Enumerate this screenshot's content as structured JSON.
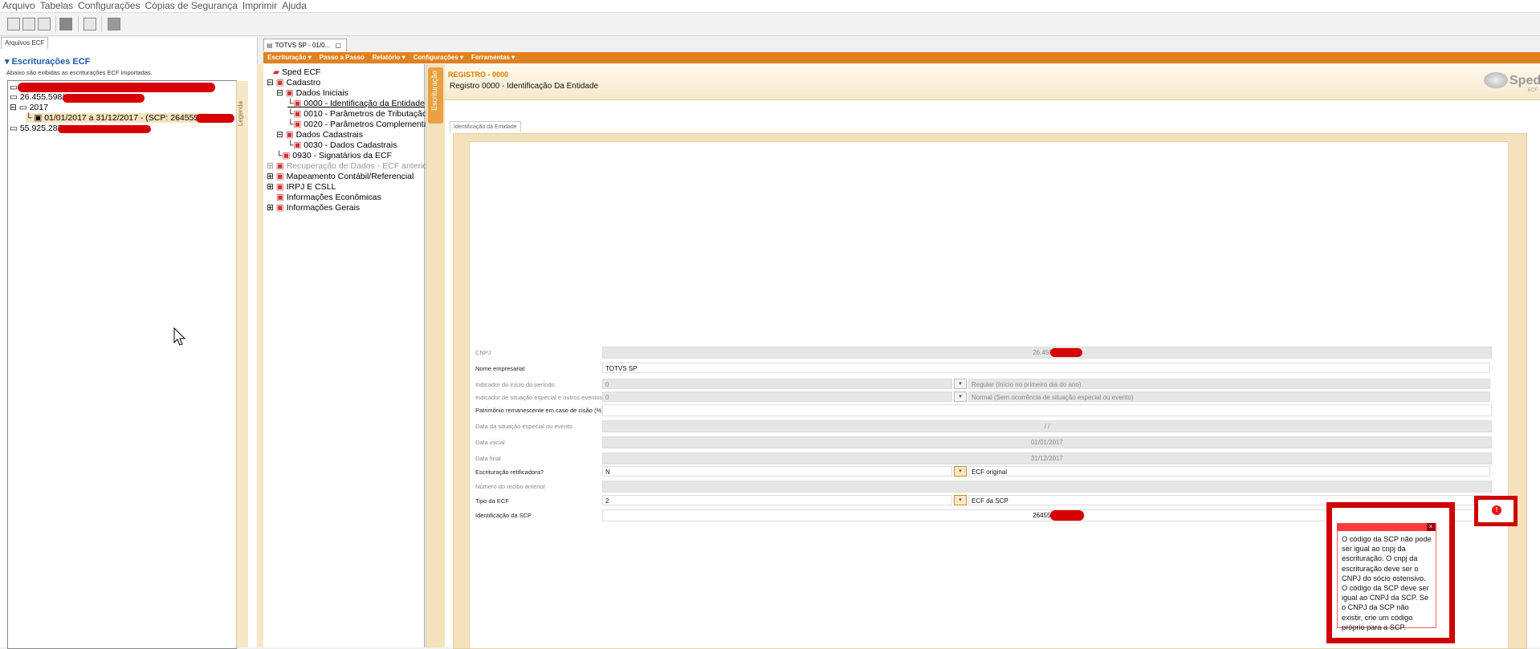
{
  "menu": [
    "Arquivo",
    "Tabelas",
    "Configurações",
    "Cópias de Segurança",
    "Imprimir",
    "Ajuda"
  ],
  "left_panel": {
    "tab": "Arquivos ECF",
    "title": "Escriturações ECF",
    "subtitle": "Abaixo são exibidas as escriturações ECF importadas.",
    "legend_label": "Legenda",
    "tree": {
      "item1": "26.455.598/",
      "year": "2017",
      "period": "01/01/2017 a 31/12/2017 - (SCP: 26455598",
      "item2": "55.925.283"
    }
  },
  "doc_tab": {
    "label": "TOTVS SP - 01/0..."
  },
  "orange_menu": [
    "Escrituração ▾",
    "Passo a Passo",
    "Relatório ▾",
    "Configurações ▾",
    "Ferramentas ▾"
  ],
  "nav_tree": {
    "root": "Sped ECF",
    "cadastro": "Cadastro",
    "dados_iniciais": "Dados Iniciais",
    "r0000": "0000 - Identificação da Entidade",
    "r0010": "0010 - Parâmetros de Tributação",
    "r0020": "0020 - Parâmetros Complementares",
    "dados_cadastrais": "Dados Cadastrais",
    "r0030": "0030 - Dados Cadastrais",
    "r0930": "0930 - Signatários da ECF",
    "recuperacao": "Recuperação de Dados - ECF anterior e EC",
    "mapeamento": "Mapeamento Contábil/Referencial",
    "irpj": "IRPJ E CSLL",
    "economicas": "Informações Econômicas",
    "gerais": "Informações Gerais"
  },
  "side_tab": "Escrituração",
  "register": {
    "code": "REGISTRO - 0000",
    "title": "Registro 0000 - Identificação Da Entidade",
    "subtab": "Identificação da Entidade"
  },
  "logo": {
    "text": "Sped",
    "sub": "ECF"
  },
  "form": {
    "cnpj_label": "CNPJ",
    "cnpj_value": "26.455.59",
    "nome_label": "Nome empresarial",
    "nome_value": "TOTVS SP",
    "ind_inicio_label": "Indicador do início do período",
    "ind_inicio_value": "0",
    "ind_inicio_desc": "Regular (Início no primeiro dia do ano)",
    "ind_sit_label": "Indicador de situação especial e outros eventos",
    "ind_sit_value": "0",
    "ind_sit_desc": "Normal (Sem ocorrência de situação especial ou evento)",
    "patrimonio_label": "Patrimônio remanescente em caso de cisão (%)",
    "data_sit_label": "Data da situação especial ou evento",
    "data_sit_value": "/ /",
    "data_ini_label": "Data inicial",
    "data_ini_value": "01/01/2017",
    "data_fin_label": "Data final",
    "data_fin_value": "31/12/2017",
    "retif_label": "Escrituração retificadora?",
    "retif_value": "N",
    "retif_desc": "ECF original",
    "recibo_label": "Número do recibo anterior",
    "tipo_label": "Tipo da ECF",
    "tipo_value": "2",
    "tipo_desc": "ECF da SCP",
    "scp_label": "Identificação da SCP",
    "scp_value": "26455598"
  },
  "error": {
    "button_glyph": "!",
    "close_glyph": "×",
    "message": "O código da SCP não pode ser igual ao cnpj da escrituração. O cnpj da escrituração deve ser o CNPJ do sócio ostensivo. O código da SCP deve ser igual ao CNPJ da SCP. Se o CNPJ da SCP não existir, crie um código próprio para a SCP."
  },
  "colors": {
    "accent": "#e0811f",
    "error": "#d00000",
    "title_blue": "#1f5aa6"
  }
}
